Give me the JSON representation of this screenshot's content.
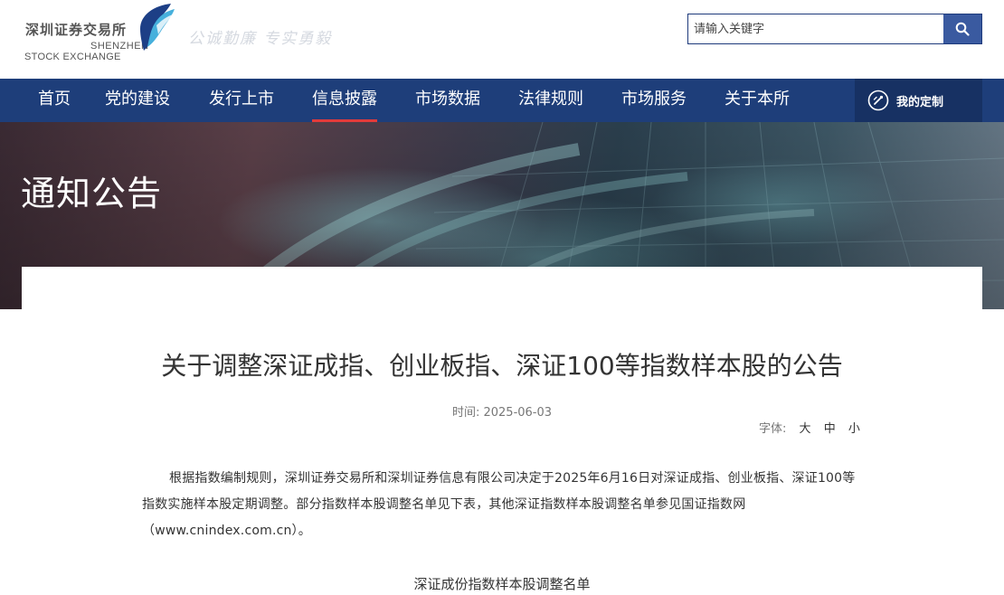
{
  "header": {
    "logo_cn": "深圳证券交易所",
    "logo_en_line1": "SHENZHEN",
    "logo_en_line2": "STOCK EXCHANGE",
    "slogan": "公诚勤廉 专实勇毅",
    "search_placeholder": "请输入关键字"
  },
  "nav": {
    "items": [
      {
        "label": "首页"
      },
      {
        "label": "党的建设"
      },
      {
        "label": "发行上市"
      },
      {
        "label": "信息披露"
      },
      {
        "label": "市场数据"
      },
      {
        "label": "法律规则"
      },
      {
        "label": "市场服务"
      },
      {
        "label": "关于本所"
      }
    ],
    "active": "信息披露",
    "custom_label": "我的定制"
  },
  "banner": {
    "title": "通知公告"
  },
  "article": {
    "title": "关于调整深证成指、创业板指、深证100等指数样本股的公告",
    "time_label": "时间:",
    "time_value": "2025-06-03",
    "font_label": "字体:",
    "font_options": [
      "大",
      "中",
      "小"
    ],
    "body": "根据指数编制规则，深圳证券交易所和深圳证券信息有限公司决定于2025年6月16日对深证成指、创业板指、深证100等指数实施样本股定期调整。部分指数样本股调整名单见下表，其他深证指数样本股调整名单参见国证指数网（www.cnindex.com.cn）。",
    "subheading": "深证成份指数样本股调整名单"
  },
  "colors": {
    "nav_bg": "#1e3e7a",
    "active_underline": "#e23b3b",
    "search_button": "#3a5aa0"
  },
  "icons": {
    "search": "search-icon",
    "custom": "customize-icon"
  }
}
